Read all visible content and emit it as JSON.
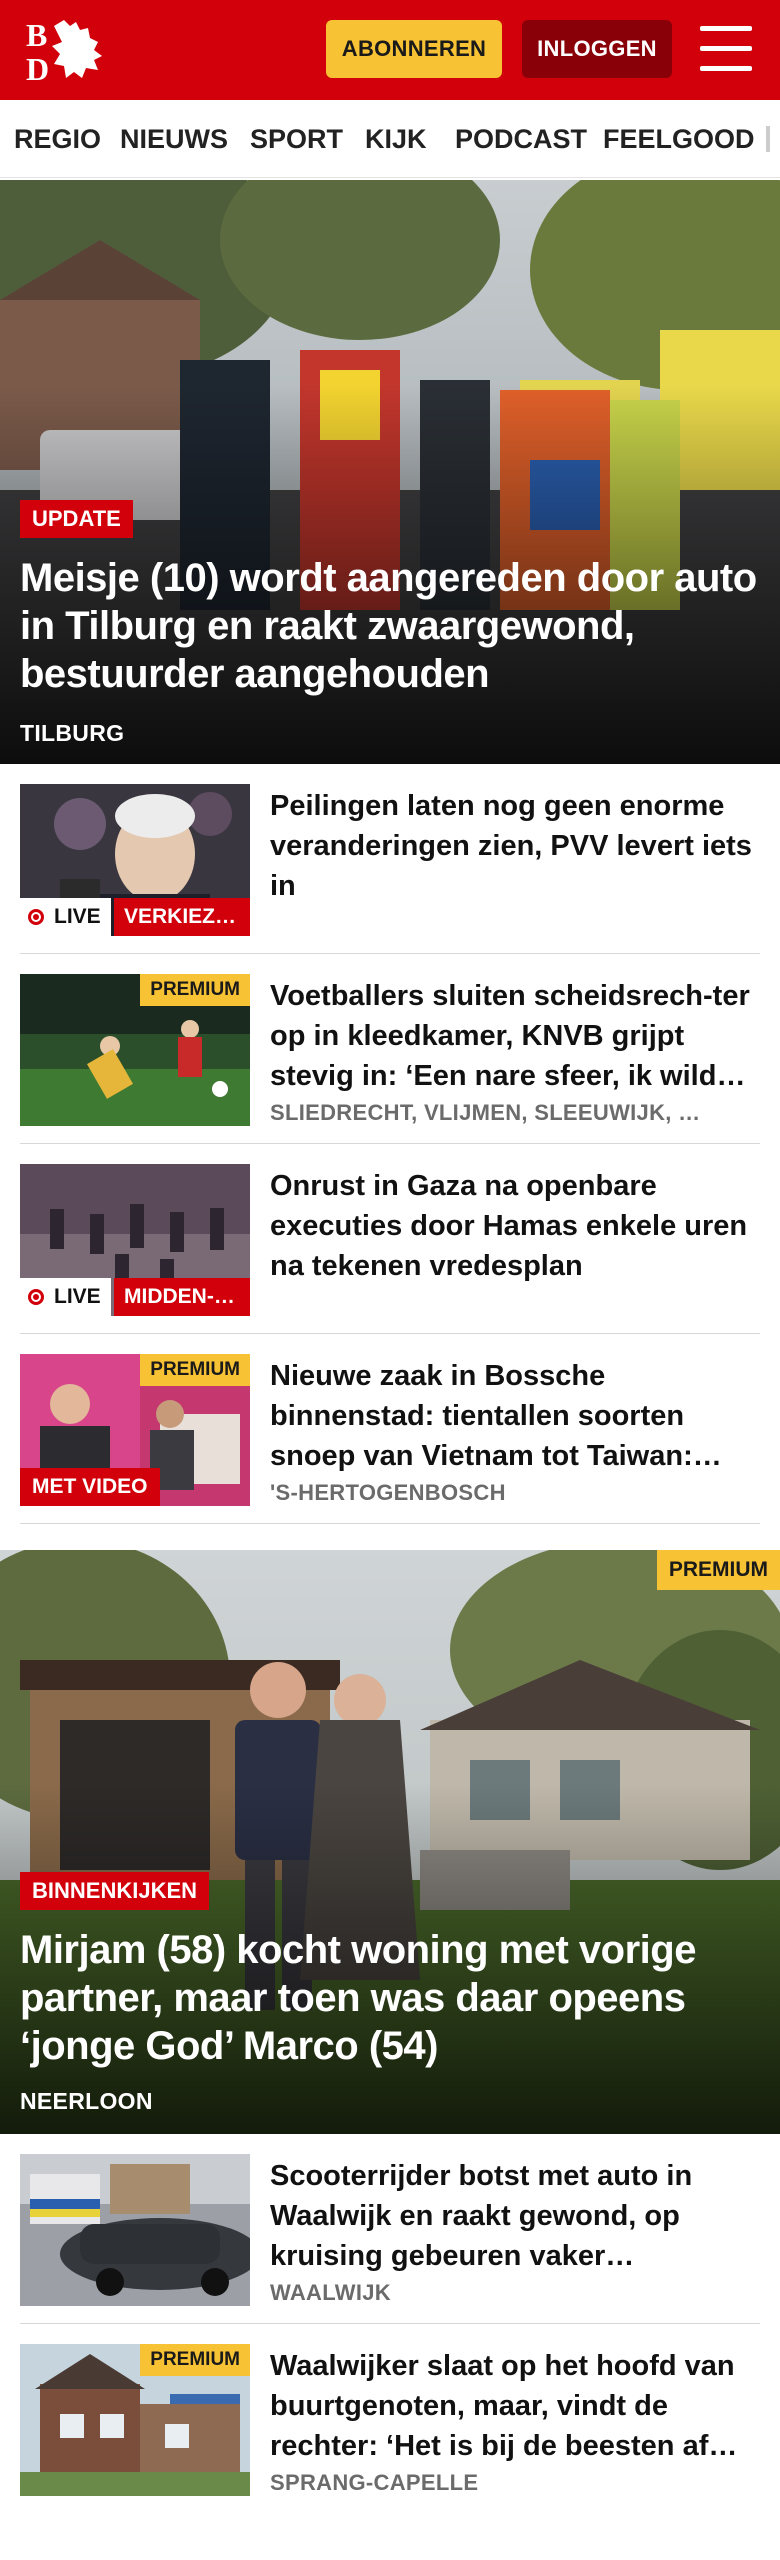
{
  "header": {
    "logo_text": "BD",
    "subscribe_label": "ABONNEREN",
    "login_label": "INLOGGEN"
  },
  "nav": {
    "items": [
      "REGIO",
      "NIEUWS",
      "SPORT",
      "KIJK",
      "PODCAST",
      "FEELGOOD"
    ]
  },
  "hero1": {
    "label": "UPDATE",
    "title": "Meisje (10) wordt aangereden door auto in Tilburg en raakt zwaargewond, bestuurder aangehouden",
    "location": "TILBURG"
  },
  "articles": [
    {
      "title": "Peilingen laten nog geen enorme veranderingen zien, PVV levert iets in",
      "live": "LIVE",
      "live_category": "VERKIEZINGEN"
    },
    {
      "title": "Voetballers sluiten scheidsrech-ter op in kleedkamer, KNVB grijpt stevig in: ‘Een nare sfeer, ik wild…",
      "premium": "PREMIUM",
      "location": "SLIEDRECHT, VLIJMEN, SLEEUWIJK, …"
    },
    {
      "title": "Onrust in Gaza na openbare executies door Hamas enkele uren na tekenen vredesplan",
      "live": "LIVE",
      "live_category": "MIDDEN-OOSTEN"
    },
    {
      "title": "Nieuwe zaak in Bossche binnenstad: tientallen soorten snoep van Vietnam tot Taiwan:…",
      "premium": "PREMIUM",
      "video": "MET VIDEO",
      "location": "'S-HERTOGENBOSCH"
    }
  ],
  "hero2": {
    "premium": "PREMIUM",
    "label": "BINNENKIJKEN",
    "title": "Mirjam (58) kocht woning met vorige partner, maar toen was daar opeens ‘jonge God’ Marco (54)",
    "location": "NEERLOON"
  },
  "articles2": [
    {
      "title": "Scooterrijder botst met auto in Waalwijk en raakt gewond, op kruising gebeuren vaker…",
      "location": "WAALWIJK"
    },
    {
      "title": "Waalwijker slaat op het hoofd van buurtgenoten, maar, vindt de rechter: ‘Het is bij de beesten af…",
      "premium": "PREMIUM",
      "location": "SPRANG-CAPELLE"
    }
  ],
  "colors": {
    "brand_red": "#d1000a",
    "premium_yellow": "#f7c233",
    "login_dark_red": "#8a0008"
  }
}
